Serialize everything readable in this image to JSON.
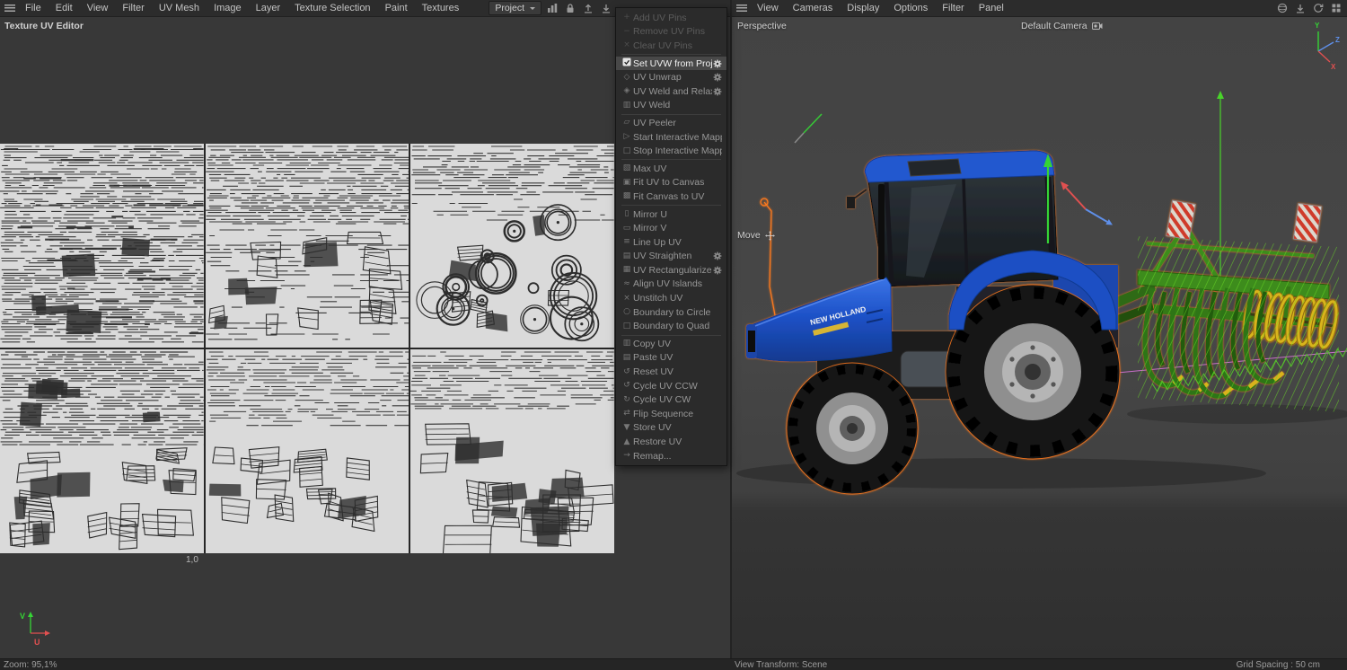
{
  "left_menubar": {
    "items": [
      "File",
      "Edit",
      "View",
      "Filter",
      "UV Mesh",
      "Image",
      "Layer",
      "Texture Selection",
      "Paint",
      "Textures"
    ],
    "project_dropdown": "Project"
  },
  "right_menubar": {
    "items": [
      "View",
      "Cameras",
      "Display",
      "Options",
      "Filter",
      "Panel"
    ]
  },
  "uv_editor": {
    "panel_title": "Texture UV Editor",
    "coord_label": "1,0",
    "axis": {
      "u": "U",
      "v": "V"
    },
    "tiles": [
      {
        "pattern": "stripes-full",
        "seed": 11
      },
      {
        "pattern": "stripes-islands",
        "seed": 23
      },
      {
        "pattern": "stripes-circles",
        "seed": 37
      },
      {
        "pattern": "stripes-blocks-dense",
        "seed": 41
      },
      {
        "pattern": "stripes-blocks-sparse",
        "seed": 53
      },
      {
        "pattern": "stripes-blocks-large",
        "seed": 67
      }
    ]
  },
  "context_menu": {
    "items": [
      {
        "label": "Add UV Pins",
        "icon": "+",
        "enabled": false
      },
      {
        "label": "Remove UV Pins",
        "icon": "−",
        "enabled": false
      },
      {
        "label": "Clear UV Pins",
        "icon": "×",
        "enabled": false
      },
      {
        "sep": true
      },
      {
        "label": "Set UVW from Projection",
        "icon": "▦",
        "enabled": true,
        "highlight": true,
        "gear": true
      },
      {
        "label": "UV Unwrap",
        "icon": "◇",
        "enabled": true,
        "gear": true
      },
      {
        "label": "UV Weld and Relax",
        "icon": "◈",
        "enabled": true,
        "gear": true
      },
      {
        "label": "UV Weld",
        "icon": "▥",
        "enabled": true
      },
      {
        "sep": true
      },
      {
        "label": "UV Peeler",
        "icon": "▱",
        "enabled": true
      },
      {
        "label": "Start Interactive Mapping",
        "icon": "▷",
        "enabled": true
      },
      {
        "label": "Stop Interactive Mapping",
        "icon": "□",
        "enabled": true
      },
      {
        "sep": true
      },
      {
        "label": "Max UV",
        "icon": "▧",
        "enabled": true
      },
      {
        "label": "Fit UV to Canvas",
        "icon": "▣",
        "enabled": true
      },
      {
        "label": "Fit Canvas to UV",
        "icon": "▩",
        "enabled": true
      },
      {
        "sep": true
      },
      {
        "label": "Mirror U",
        "icon": "▯",
        "enabled": true
      },
      {
        "label": "Mirror V",
        "icon": "▭",
        "enabled": true
      },
      {
        "label": "Line Up UV",
        "icon": "≡",
        "enabled": true
      },
      {
        "label": "UV Straighten",
        "icon": "▤",
        "enabled": true,
        "gear": true
      },
      {
        "label": "UV Rectangularize",
        "icon": "▦",
        "enabled": true,
        "gear": true
      },
      {
        "label": "Align UV Islands",
        "icon": "≈",
        "enabled": true
      },
      {
        "label": "Unstitch UV",
        "icon": "×",
        "enabled": true
      },
      {
        "label": "Boundary to Circle",
        "icon": "○",
        "enabled": true
      },
      {
        "label": "Boundary to Quad",
        "icon": "□",
        "enabled": true
      },
      {
        "sep": true
      },
      {
        "label": "Copy UV",
        "icon": "▥",
        "enabled": true
      },
      {
        "label": "Paste UV",
        "icon": "▤",
        "enabled": true
      },
      {
        "label": "Reset UV",
        "icon": "↺",
        "enabled": true
      },
      {
        "label": "Cycle UV CCW",
        "icon": "↺",
        "enabled": true
      },
      {
        "label": "Cycle UV CW",
        "icon": "↻",
        "enabled": true
      },
      {
        "label": "Flip Sequence",
        "icon": "⇄",
        "enabled": true
      },
      {
        "label": "Store UV",
        "icon": "▼",
        "enabled": true
      },
      {
        "label": "Restore UV",
        "icon": "▲",
        "enabled": true
      },
      {
        "label": "Remap...",
        "icon": "→",
        "enabled": true
      }
    ]
  },
  "viewport": {
    "view_label": "Perspective",
    "camera_label": "Default Camera",
    "tool_label": "Move",
    "axis": {
      "x": "X",
      "y": "Y",
      "z": "Z"
    },
    "tractor_brand": "NEW HOLLAND"
  },
  "statusbar": {
    "zoom": "Zoom: 95,1%",
    "view_transform": "View Transform: Scene",
    "grid_spacing": "Grid Spacing : 50 cm"
  },
  "colors": {
    "selection_orange": "#ff7a1e",
    "axis_green": "#35d435",
    "axis_red": "#e05050",
    "axis_blue": "#5f8fe8",
    "implement_green": "#3e8c1f",
    "roller_yellow": "#d9b31c",
    "tractor_blue": "#1e52c8"
  }
}
